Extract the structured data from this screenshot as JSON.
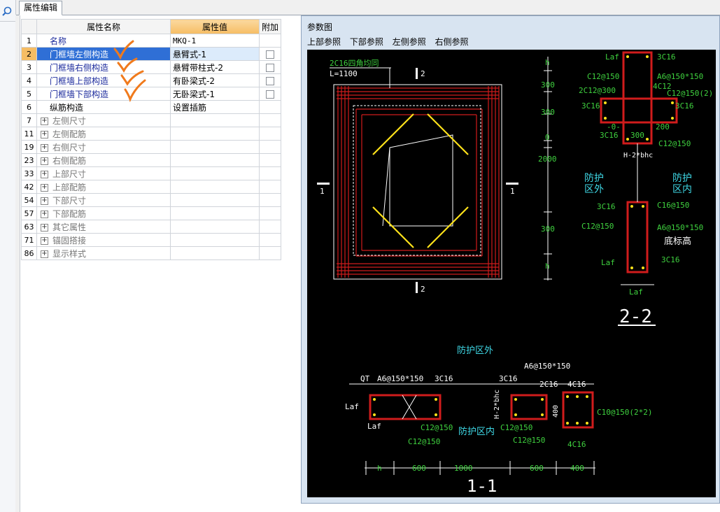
{
  "tab": {
    "label": "属性编辑"
  },
  "grid": {
    "headers": {
      "name": "属性名称",
      "value": "属性值",
      "extra": "附加"
    },
    "rows": [
      {
        "num": "1",
        "name": "名称",
        "value": "MKQ-1"
      },
      {
        "num": "2",
        "name": "门框墙左侧构造",
        "value": "悬臂式-1"
      },
      {
        "num": "3",
        "name": "门框墙右侧构造",
        "value": "悬臂带柱式-2"
      },
      {
        "num": "4",
        "name": "门框墙上部构造",
        "value": "有卧梁式-2"
      },
      {
        "num": "5",
        "name": "门框墙下部构造",
        "value": "无卧梁式-1"
      },
      {
        "num": "6",
        "name": "纵筋构造",
        "value": "设置插筋"
      },
      {
        "num": "7",
        "name": "左侧尺寸"
      },
      {
        "num": "11",
        "name": "左侧配筋"
      },
      {
        "num": "19",
        "name": "右侧尺寸"
      },
      {
        "num": "23",
        "name": "右侧配筋"
      },
      {
        "num": "33",
        "name": "上部尺寸"
      },
      {
        "num": "42",
        "name": "上部配筋"
      },
      {
        "num": "54",
        "name": "下部尺寸"
      },
      {
        "num": "57",
        "name": "下部配筋"
      },
      {
        "num": "63",
        "name": "其它属性"
      },
      {
        "num": "71",
        "name": "锚固搭接"
      },
      {
        "num": "86",
        "name": "显示样式"
      }
    ]
  },
  "panel": {
    "title": "参数图",
    "refs": [
      "上部参照",
      "下部参照",
      "左侧参照",
      "右侧参照"
    ]
  },
  "drawing": {
    "a": {
      "label": "2C16四角均同",
      "length": "L=1100",
      "cut2": "2",
      "cut1": "1"
    },
    "b": {
      "title": "2-2",
      "dims": [
        "h",
        "300",
        "300",
        "0",
        "2000",
        "300",
        "h"
      ],
      "labels": [
        "Laf",
        "3C16",
        "C12@150",
        "A6@150*150",
        "2C12@300",
        "4C12",
        "C12@150(2)",
        "3C16",
        "3C16",
        "-0-",
        "3C16",
        "300",
        "200",
        "C12@150",
        "H-2*bhc",
        "防护",
        "区外",
        "防护",
        "区内",
        "3C16",
        "C16@150",
        "C12@150",
        "A6@150*150",
        "底标高",
        "Laf",
        "3C16",
        "Laf"
      ]
    },
    "c": {
      "title": "1-1",
      "heading": "防护区外",
      "labels": [
        "QT",
        "A6@150*150",
        "3C16",
        "Laf",
        "Laf",
        "C12@150",
        "C12@150",
        "防护区内",
        "A6@150*150",
        "3C16",
        "2C16",
        "4C16",
        "H-2*bhc",
        "400",
        "C12@150",
        "C12@150",
        "C10@150(2*2)",
        "4C16"
      ],
      "dims": [
        "h",
        "600",
        "1000",
        "600",
        "400"
      ]
    }
  },
  "colors": {
    "selected_row": "#2f6fd6",
    "header_value": "#f6bd64",
    "check_mark": "#f07a1c",
    "drawing_green": "#3fd23f",
    "drawing_red": "#d01c1c",
    "drawing_yellow": "#ffe21a",
    "drawing_cyan": "#3fd8e6"
  }
}
